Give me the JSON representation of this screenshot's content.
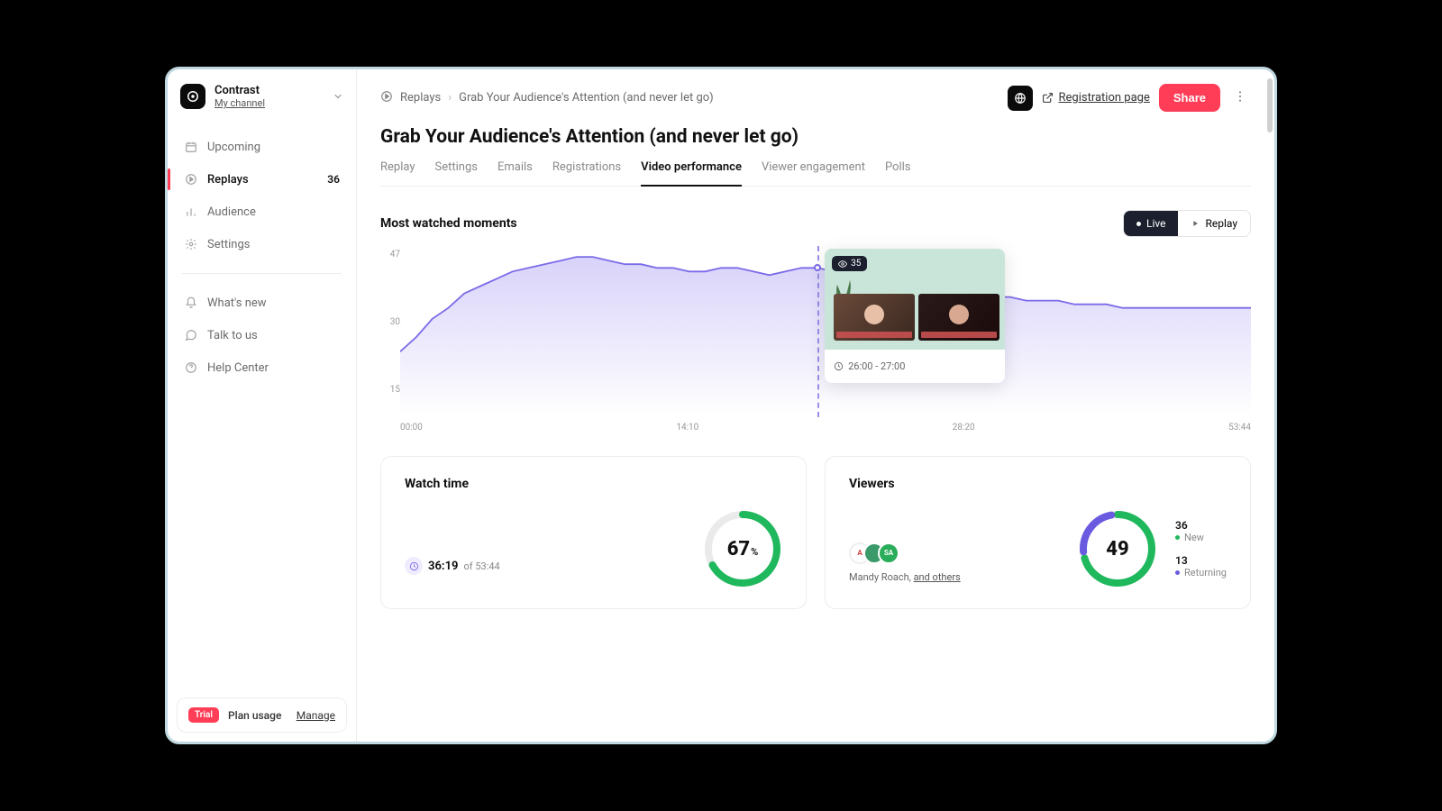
{
  "workspace": {
    "name": "Contrast",
    "subtitle": "My channel"
  },
  "sidebar": {
    "items": [
      {
        "label": "Upcoming"
      },
      {
        "label": "Replays",
        "count": "36"
      },
      {
        "label": "Audience"
      },
      {
        "label": "Settings"
      }
    ],
    "secondary": [
      {
        "label": "What's new"
      },
      {
        "label": "Talk to us"
      },
      {
        "label": "Help Center"
      }
    ],
    "trial_badge": "Trial",
    "plan_usage": "Plan usage",
    "manage": "Manage"
  },
  "breadcrumb": {
    "root": "Replays",
    "current": "Grab Your Audience's Attention (and never let go)"
  },
  "topbar": {
    "registration": "Registration page",
    "share": "Share"
  },
  "page_title": "Grab Your Audience's Attention (and never let go)",
  "tabs": [
    "Replay",
    "Settings",
    "Emails",
    "Registrations",
    "Video performance",
    "Viewer engagement",
    "Polls"
  ],
  "active_tab": "Video performance",
  "section_title": "Most watched moments",
  "toggle": {
    "live": "Live",
    "replay": "Replay"
  },
  "chart_data": {
    "type": "area",
    "ylim": [
      0,
      47
    ],
    "y_ticks": [
      "47",
      "30",
      "15"
    ],
    "x_ticks": [
      "00:00",
      "14:10",
      "28:20",
      "53:44"
    ],
    "series_label": "Viewers",
    "x": [
      0,
      1,
      2,
      3,
      4,
      5,
      6,
      7,
      8,
      9,
      10,
      11,
      12,
      13,
      14,
      15,
      16,
      17,
      18,
      19,
      20,
      21,
      22,
      23,
      24,
      25,
      26,
      27,
      28,
      29,
      30,
      31,
      32,
      33,
      34,
      35,
      36,
      37,
      38,
      39,
      40,
      41,
      42,
      43,
      44,
      45,
      46,
      47,
      48,
      49,
      50,
      51,
      52,
      53
    ],
    "values": [
      18,
      22,
      27,
      30,
      34,
      36,
      38,
      40,
      41,
      42,
      43,
      44,
      44,
      43,
      42,
      42,
      41,
      41,
      40,
      40,
      41,
      41,
      40,
      39,
      40,
      41,
      41,
      40,
      39,
      38,
      37,
      36,
      35,
      35,
      34,
      34,
      33,
      33,
      33,
      32,
      32,
      32,
      31,
      31,
      31,
      30,
      30,
      30,
      30,
      30,
      30,
      30,
      30,
      30
    ],
    "hover": {
      "x_index": 26,
      "value": 35,
      "time_label": "26:00 - 27:00"
    }
  },
  "watch_card": {
    "title": "Watch time",
    "percent": 67,
    "time_value": "36:19",
    "time_prefix": "of",
    "time_total": "53:44"
  },
  "viewers_card": {
    "title": "Viewers",
    "total": "49",
    "new": {
      "count": "36",
      "label": "New"
    },
    "returning": {
      "count": "13",
      "label": "Returning"
    },
    "sample_name": "Mandy Roach,",
    "others": "and others",
    "avatar_labels": [
      "A",
      "",
      "SA"
    ]
  }
}
